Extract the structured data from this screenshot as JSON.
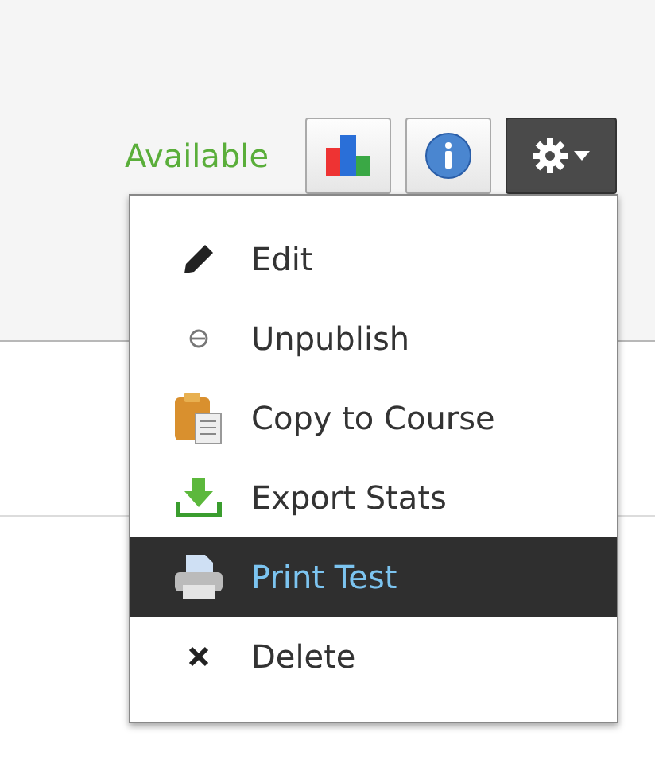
{
  "status": "Available",
  "toolbar": [
    {
      "kind": "stats"
    },
    {
      "kind": "info"
    },
    {
      "kind": "settings",
      "expanded": true
    }
  ],
  "menu": [
    {
      "kind": "edit",
      "label": "Edit",
      "selected": false
    },
    {
      "kind": "unpublish",
      "label": "Unpublish",
      "selected": false
    },
    {
      "kind": "copy",
      "label": "Copy to Course",
      "selected": false
    },
    {
      "kind": "export",
      "label": "Export Stats",
      "selected": false
    },
    {
      "kind": "print",
      "label": "Print Test",
      "selected": true
    },
    {
      "kind": "delete",
      "label": "Delete",
      "selected": false
    }
  ]
}
